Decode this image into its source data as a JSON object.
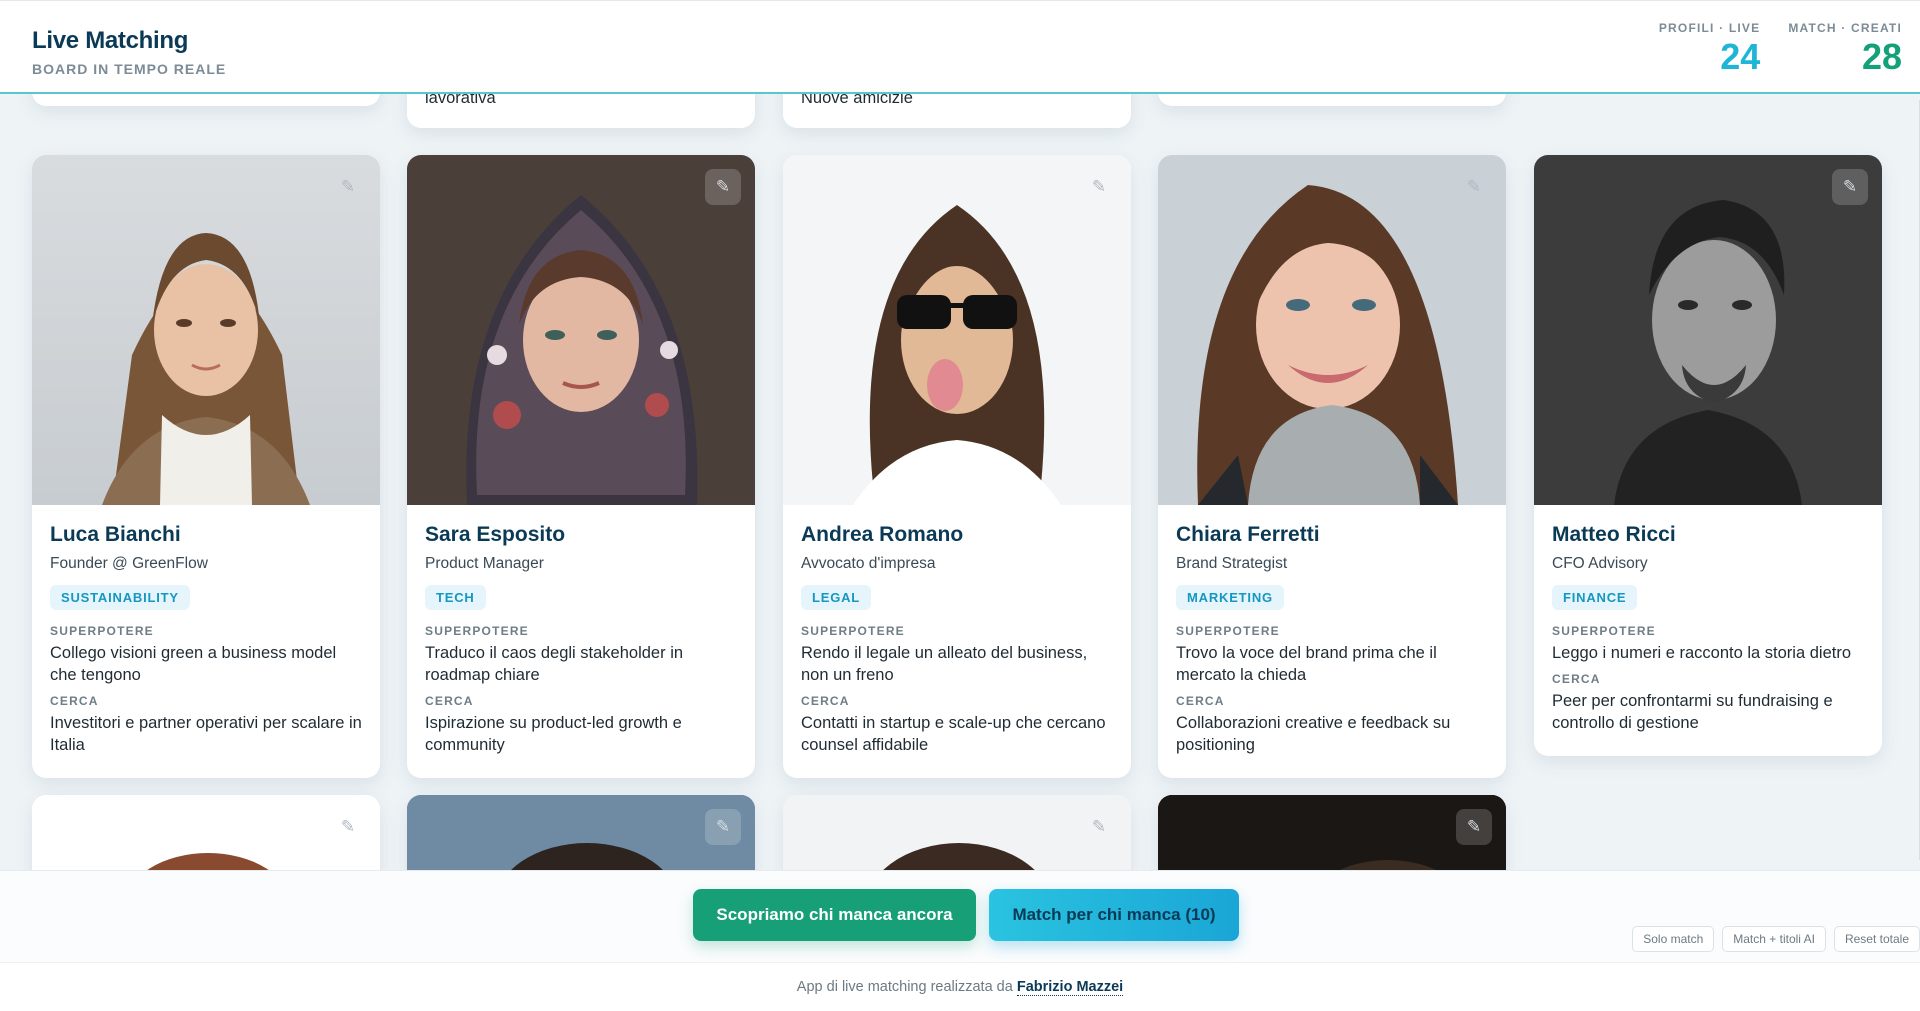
{
  "header": {
    "title": "Live Matching",
    "subtitle": "BOARD IN TEMPO REALE",
    "stats": [
      {
        "label": "PROFILI · LIVE",
        "value": "24"
      },
      {
        "label": "MATCH · CREATI",
        "value": "28"
      }
    ]
  },
  "partial_top": [
    "lavorativa",
    "Nuove amicizie"
  ],
  "labels": {
    "superpower": "SUPERPOTERE",
    "seek": "CERCA"
  },
  "profiles": [
    {
      "name": "Luca Bianchi",
      "role": "Founder @ GreenFlow",
      "tag": "SUSTAINABILITY",
      "superpower": "Collego visioni green a business model che tengono",
      "seek": "Investitori e partner operativi per scalare in Italia"
    },
    {
      "name": "Sara Esposito",
      "role": "Product Manager",
      "tag": "TECH",
      "superpower": "Traduco il caos degli stakeholder in roadmap chiare",
      "seek": "Ispirazione su product-led growth e community"
    },
    {
      "name": "Andrea Romano",
      "role": "Avvocato d'impresa",
      "tag": "LEGAL",
      "superpower": "Rendo il legale un alleato del business, non un freno",
      "seek": "Contatti in startup e scale-up che cercano counsel affidabile"
    },
    {
      "name": "Chiara Ferretti",
      "role": "Brand Strategist",
      "tag": "MARKETING",
      "superpower": "Trovo la voce del brand prima che il mercato la chieda",
      "seek": "Collaborazioni creative e feedback su positioning"
    },
    {
      "name": "Matteo Ricci",
      "role": "CFO Advisory",
      "tag": "FINANCE",
      "superpower": "Leggo i numeri e racconto la storia dietro",
      "seek": "Peer per confrontarmi su fundraising e controllo di gestione"
    }
  ],
  "actions": {
    "primary": "Scopriamo chi manca ancora",
    "secondary": "Match per chi manca (10)",
    "mini": [
      "Solo match",
      "Match + titoli AI",
      "Reset totale"
    ]
  },
  "footer": {
    "text": "App di live matching realizzata da ",
    "author": "Fabrizio Mazzei"
  },
  "icons": {
    "edit": "edit-icon"
  },
  "colors": {
    "accent_green": "#17a078",
    "accent_cyan": "#1fb5d6",
    "navy": "#0b3a57",
    "tag_bg": "#e6f5fb"
  }
}
